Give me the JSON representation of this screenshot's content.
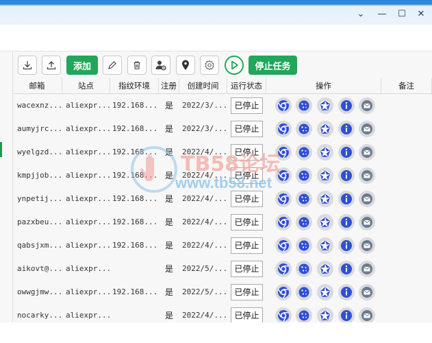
{
  "window": {
    "controls": [
      "⌄",
      "—",
      "☐",
      "✕"
    ]
  },
  "toolbar": {
    "add_label": "添加",
    "stop_task_label": "停止任务"
  },
  "table": {
    "headers": [
      "邮箱",
      "站点",
      "指纹环境",
      "注册",
      "创建时间",
      "运行状态",
      "操作",
      "备注"
    ],
    "rows": [
      {
        "email": "wacexnz...",
        "site": "aliexpr...",
        "env": "192.168...",
        "reg": "是",
        "time": "2022/3/...",
        "status": "已停止"
      },
      {
        "email": "aumyjrc...",
        "site": "aliexpr...",
        "env": "192.168...",
        "reg": "是",
        "time": "2022/3/...",
        "status": "已停止"
      },
      {
        "email": "wyelgzd...",
        "site": "aliexpr...",
        "env": "192.168...",
        "reg": "是",
        "time": "2022/4/...",
        "status": "已停止"
      },
      {
        "email": "kmpjjob...",
        "site": "aliexpr...",
        "env": "192.168...",
        "reg": "是",
        "time": "2022/4/...",
        "status": "已停止"
      },
      {
        "email": "ynpetij...",
        "site": "aliexpr...",
        "env": "192.168...",
        "reg": "是",
        "time": "2022/4/...",
        "status": "已停止"
      },
      {
        "email": "pazxbeu...",
        "site": "aliexpr...",
        "env": "192.168...",
        "reg": "是",
        "time": "2022/4/...",
        "status": "已停止"
      },
      {
        "email": "qabsjxm...",
        "site": "aliexpr...",
        "env": "192.168...",
        "reg": "是",
        "time": "2022/4/...",
        "status": "已停止"
      },
      {
        "email": "aikovt@...",
        "site": "aliexpr...",
        "env": "",
        "reg": "是",
        "time": "2022/5/...",
        "status": "已停止"
      },
      {
        "email": "owwgjmw...",
        "site": "aliexpr...",
        "env": "192.168...",
        "reg": "是",
        "time": "2022/5/...",
        "status": "已停止"
      },
      {
        "email": "nocarky...",
        "site": "aliexpr...",
        "env": "",
        "reg": "是",
        "time": "2022/4/...",
        "status": "已停止"
      }
    ]
  },
  "watermark": {
    "title": "TB58论坛",
    "url": "www.tb58.net"
  },
  "colors": {
    "accent_green": "#21a65a",
    "action_blue": "#2f4fd6",
    "titlebar_blue": "#2b86d8"
  }
}
